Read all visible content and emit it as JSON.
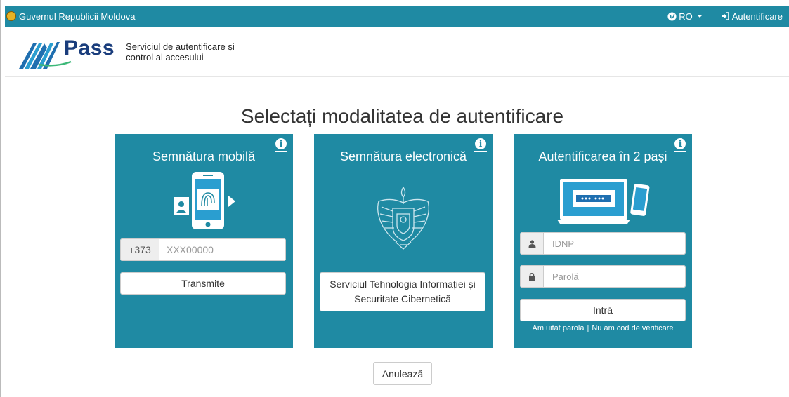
{
  "topbar": {
    "government": "Guvernul Republicii Moldova",
    "language": "RO",
    "login": "Autentificare"
  },
  "header": {
    "logo_text": "Pass",
    "tagline_line1": "Serviciul de autentificare și",
    "tagline_line2": "control al accesului"
  },
  "page_title": "Selectați modalitatea de autentificare",
  "cards": {
    "mobile": {
      "title": "Semnătura mobilă",
      "prefix": "+373",
      "phone_placeholder": "XXX00000",
      "submit": "Transmite"
    },
    "electronic": {
      "title": "Semnătura electronică",
      "provider": "Serviciul Tehnologia Informației și Securitate Cibernetică"
    },
    "twostep": {
      "title": "Autentificarea în 2 pași",
      "idnp_placeholder": "IDNP",
      "password_placeholder": "Parolă",
      "submit": "Intră",
      "forgot": "Am uitat parola",
      "separator": "|",
      "no_code": "Nu am cod de verificare"
    }
  },
  "cancel": "Anulează",
  "colors": {
    "accent": "#1f8aa3",
    "logo": "#1a3d7c"
  }
}
